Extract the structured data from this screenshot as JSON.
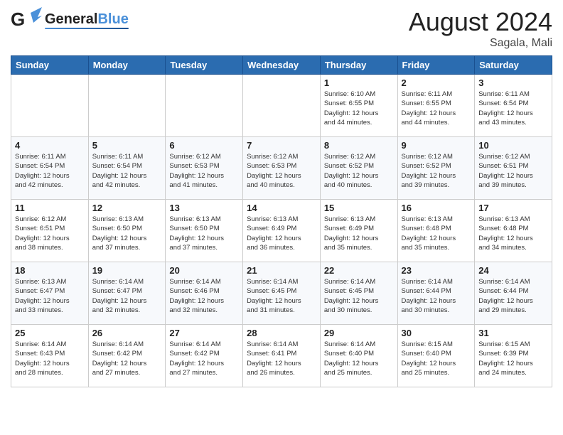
{
  "header": {
    "logo": "GeneralBlue",
    "month": "August 2024",
    "location": "Sagala, Mali"
  },
  "weekdays": [
    "Sunday",
    "Monday",
    "Tuesday",
    "Wednesday",
    "Thursday",
    "Friday",
    "Saturday"
  ],
  "weeks": [
    [
      {
        "day": "",
        "info": ""
      },
      {
        "day": "",
        "info": ""
      },
      {
        "day": "",
        "info": ""
      },
      {
        "day": "",
        "info": ""
      },
      {
        "day": "1",
        "info": "Sunrise: 6:10 AM\nSunset: 6:55 PM\nDaylight: 12 hours\nand 44 minutes."
      },
      {
        "day": "2",
        "info": "Sunrise: 6:11 AM\nSunset: 6:55 PM\nDaylight: 12 hours\nand 44 minutes."
      },
      {
        "day": "3",
        "info": "Sunrise: 6:11 AM\nSunset: 6:54 PM\nDaylight: 12 hours\nand 43 minutes."
      }
    ],
    [
      {
        "day": "4",
        "info": "Sunrise: 6:11 AM\nSunset: 6:54 PM\nDaylight: 12 hours\nand 42 minutes."
      },
      {
        "day": "5",
        "info": "Sunrise: 6:11 AM\nSunset: 6:54 PM\nDaylight: 12 hours\nand 42 minutes."
      },
      {
        "day": "6",
        "info": "Sunrise: 6:12 AM\nSunset: 6:53 PM\nDaylight: 12 hours\nand 41 minutes."
      },
      {
        "day": "7",
        "info": "Sunrise: 6:12 AM\nSunset: 6:53 PM\nDaylight: 12 hours\nand 40 minutes."
      },
      {
        "day": "8",
        "info": "Sunrise: 6:12 AM\nSunset: 6:52 PM\nDaylight: 12 hours\nand 40 minutes."
      },
      {
        "day": "9",
        "info": "Sunrise: 6:12 AM\nSunset: 6:52 PM\nDaylight: 12 hours\nand 39 minutes."
      },
      {
        "day": "10",
        "info": "Sunrise: 6:12 AM\nSunset: 6:51 PM\nDaylight: 12 hours\nand 39 minutes."
      }
    ],
    [
      {
        "day": "11",
        "info": "Sunrise: 6:12 AM\nSunset: 6:51 PM\nDaylight: 12 hours\nand 38 minutes."
      },
      {
        "day": "12",
        "info": "Sunrise: 6:13 AM\nSunset: 6:50 PM\nDaylight: 12 hours\nand 37 minutes."
      },
      {
        "day": "13",
        "info": "Sunrise: 6:13 AM\nSunset: 6:50 PM\nDaylight: 12 hours\nand 37 minutes."
      },
      {
        "day": "14",
        "info": "Sunrise: 6:13 AM\nSunset: 6:49 PM\nDaylight: 12 hours\nand 36 minutes."
      },
      {
        "day": "15",
        "info": "Sunrise: 6:13 AM\nSunset: 6:49 PM\nDaylight: 12 hours\nand 35 minutes."
      },
      {
        "day": "16",
        "info": "Sunrise: 6:13 AM\nSunset: 6:48 PM\nDaylight: 12 hours\nand 35 minutes."
      },
      {
        "day": "17",
        "info": "Sunrise: 6:13 AM\nSunset: 6:48 PM\nDaylight: 12 hours\nand 34 minutes."
      }
    ],
    [
      {
        "day": "18",
        "info": "Sunrise: 6:13 AM\nSunset: 6:47 PM\nDaylight: 12 hours\nand 33 minutes."
      },
      {
        "day": "19",
        "info": "Sunrise: 6:14 AM\nSunset: 6:47 PM\nDaylight: 12 hours\nand 32 minutes."
      },
      {
        "day": "20",
        "info": "Sunrise: 6:14 AM\nSunset: 6:46 PM\nDaylight: 12 hours\nand 32 minutes."
      },
      {
        "day": "21",
        "info": "Sunrise: 6:14 AM\nSunset: 6:45 PM\nDaylight: 12 hours\nand 31 minutes."
      },
      {
        "day": "22",
        "info": "Sunrise: 6:14 AM\nSunset: 6:45 PM\nDaylight: 12 hours\nand 30 minutes."
      },
      {
        "day": "23",
        "info": "Sunrise: 6:14 AM\nSunset: 6:44 PM\nDaylight: 12 hours\nand 30 minutes."
      },
      {
        "day": "24",
        "info": "Sunrise: 6:14 AM\nSunset: 6:44 PM\nDaylight: 12 hours\nand 29 minutes."
      }
    ],
    [
      {
        "day": "25",
        "info": "Sunrise: 6:14 AM\nSunset: 6:43 PM\nDaylight: 12 hours\nand 28 minutes."
      },
      {
        "day": "26",
        "info": "Sunrise: 6:14 AM\nSunset: 6:42 PM\nDaylight: 12 hours\nand 27 minutes."
      },
      {
        "day": "27",
        "info": "Sunrise: 6:14 AM\nSunset: 6:42 PM\nDaylight: 12 hours\nand 27 minutes."
      },
      {
        "day": "28",
        "info": "Sunrise: 6:14 AM\nSunset: 6:41 PM\nDaylight: 12 hours\nand 26 minutes."
      },
      {
        "day": "29",
        "info": "Sunrise: 6:14 AM\nSunset: 6:40 PM\nDaylight: 12 hours\nand 25 minutes."
      },
      {
        "day": "30",
        "info": "Sunrise: 6:15 AM\nSunset: 6:40 PM\nDaylight: 12 hours\nand 25 minutes."
      },
      {
        "day": "31",
        "info": "Sunrise: 6:15 AM\nSunset: 6:39 PM\nDaylight: 12 hours\nand 24 minutes."
      }
    ]
  ]
}
